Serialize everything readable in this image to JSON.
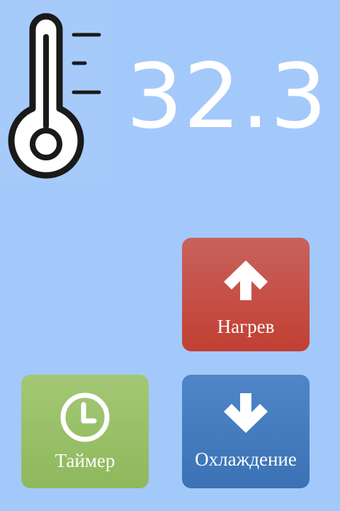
{
  "status": {
    "thermometer_icon": "thermometer-icon",
    "temperature": "32.3"
  },
  "controls": {
    "heat": {
      "label": "Нагрев",
      "icon": "arrow-up-icon",
      "color": "#c5443a"
    },
    "timer": {
      "label": "Таймер",
      "icon": "clock-icon",
      "color": "#98bf66"
    },
    "cool": {
      "label": "Охлаждение",
      "icon": "arrow-down-icon",
      "color": "#4079bd"
    }
  },
  "colors": {
    "background": "#a3c9fb",
    "text": "#ffffff"
  }
}
